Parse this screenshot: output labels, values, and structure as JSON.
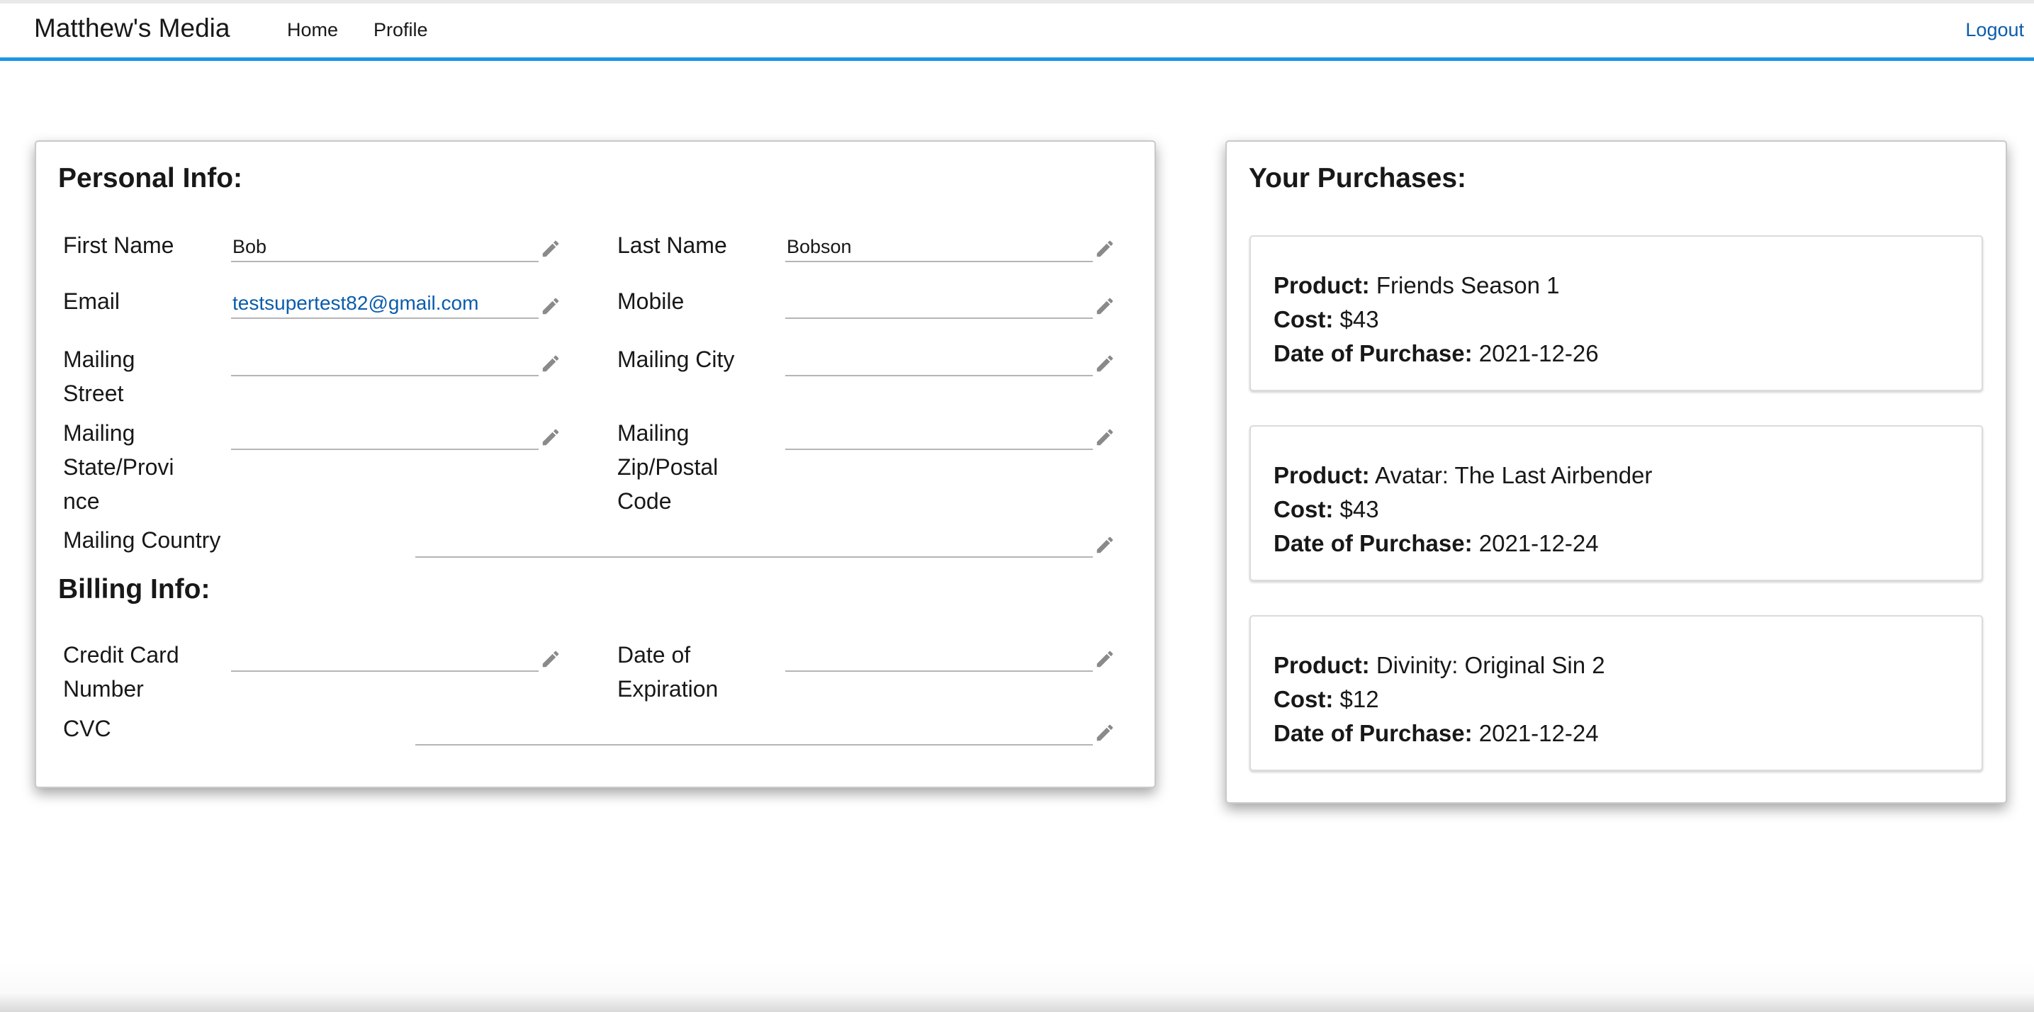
{
  "header": {
    "brand": "Matthew's Media",
    "nav": [
      {
        "label": "Home"
      },
      {
        "label": "Profile"
      }
    ],
    "logout": "Logout"
  },
  "personal": {
    "title": "Personal Info:",
    "fields": {
      "first_name": {
        "label": "First Name",
        "value": "Bob"
      },
      "last_name": {
        "label": "Last Name",
        "value": "Bobson"
      },
      "email": {
        "label": "Email",
        "value": "testsupertest82@gmail.com"
      },
      "mobile": {
        "label": "Mobile",
        "value": ""
      },
      "mailing_street": {
        "label_lines": [
          "Mailing",
          "Street"
        ],
        "value": ""
      },
      "mailing_city": {
        "label": "Mailing City",
        "value": ""
      },
      "mailing_state": {
        "label_lines": [
          "Mailing",
          "State/Provi",
          "nce"
        ],
        "value": ""
      },
      "mailing_zip": {
        "label_lines": [
          "Mailing",
          "Zip/Postal",
          "Code"
        ],
        "value": ""
      },
      "mailing_country": {
        "label": "Mailing Country",
        "value": ""
      }
    }
  },
  "billing": {
    "title": "Billing Info:",
    "fields": {
      "cc_number": {
        "label_lines": [
          "Credit Card",
          "Number"
        ],
        "value": ""
      },
      "expiration": {
        "label_lines": [
          "Date of",
          "Expiration"
        ],
        "value": ""
      },
      "cvc": {
        "label": "CVC",
        "value": ""
      }
    }
  },
  "purchases": {
    "title": "Your Purchases:",
    "labels": {
      "product": "Product:",
      "cost": "Cost:",
      "date": "Date of Purchase:"
    },
    "items": [
      {
        "product": "Friends Season 1",
        "cost": "$43",
        "date": "2021-12-26"
      },
      {
        "product": "Avatar: The Last Airbender",
        "cost": "$43",
        "date": "2021-12-24"
      },
      {
        "product": "Divinity: Original Sin 2",
        "cost": "$12",
        "date": "2021-12-24"
      }
    ]
  },
  "icons": {
    "edit": "pencil-icon"
  },
  "colors": {
    "accent": "#1b96e6",
    "link": "#0b5cab"
  }
}
